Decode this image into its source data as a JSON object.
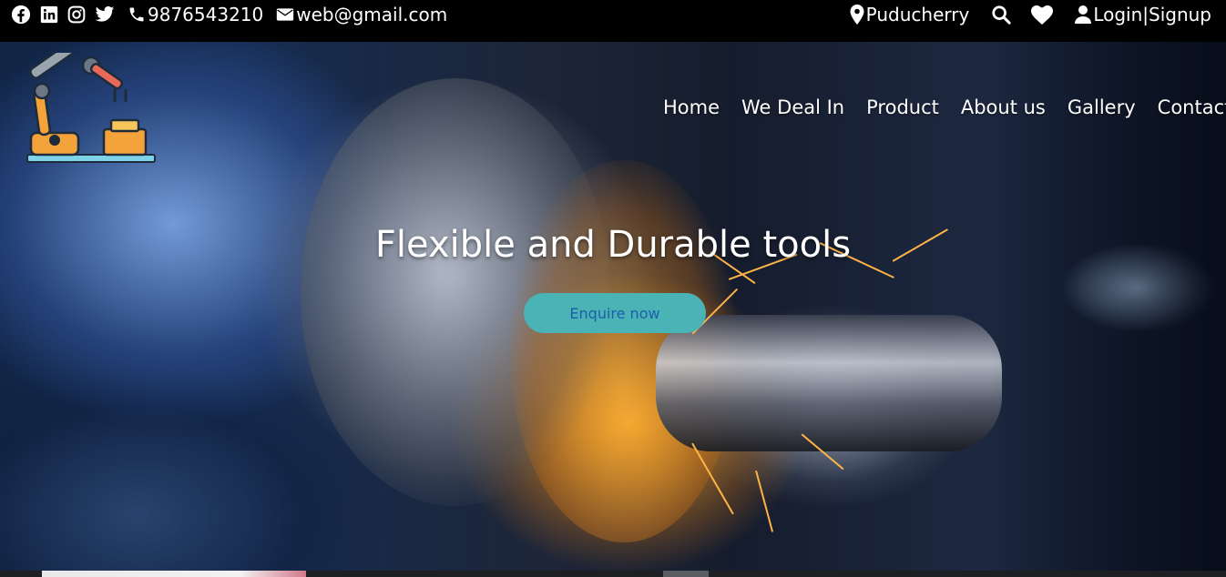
{
  "topbar": {
    "social_icons": [
      "facebook-icon",
      "linkedin-icon",
      "instagram-icon",
      "twitter-icon"
    ],
    "phone": "9876543210",
    "email": "web@gmail.com",
    "location": "Puducherry",
    "login_signup": "Login|Signup"
  },
  "nav": {
    "items": [
      "Home",
      "We Deal In",
      "Product",
      "About us",
      "Gallery",
      "Contact us"
    ]
  },
  "hero": {
    "headline": "Flexible and Durable tools",
    "cta_label": "Enquire now"
  },
  "colors": {
    "topbar_bg": "#000000",
    "cta_bg": "#4ab3b5",
    "cta_text": "#1d5ea8"
  }
}
